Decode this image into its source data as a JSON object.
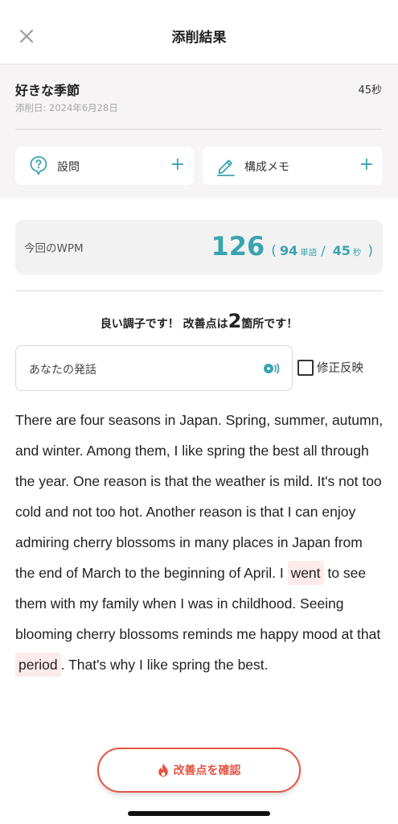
{
  "header": {
    "title": "添削結果",
    "close_icon": "close-icon"
  },
  "topic": {
    "title": "好きな季節",
    "duration": "45秒",
    "date": "添削日: 2024年6月28日"
  },
  "cards": {
    "question_label": "設問",
    "question_icon": "question-circle-icon",
    "memo_label": "構成メモ",
    "memo_icon": "pencil-icon",
    "plus": "+"
  },
  "wpm": {
    "label": "今回のWPM",
    "value": "126",
    "open_paren": "(",
    "words": "94",
    "words_unit": "単語",
    "slash": "/",
    "seconds": "45",
    "seconds_unit": "秒",
    "close_paren": ")"
  },
  "feedback": {
    "prefix": "良い調子です！ 改善点は",
    "count": "2",
    "suffix": "箇所です！"
  },
  "speech": {
    "label": "あなたの発話",
    "audio_icon": "speaker-icon",
    "reflect_label": "修正反映",
    "reflect_checked": false
  },
  "essay": {
    "part1": "There are four seasons in Japan. Spring, summer, autumn, and winter. Among them, I like spring the best all through the year. One reason is that the weather is mild. It's not too cold and not too hot. Another reason is that I can enjoy admiring cherry blossoms in many places in Japan from the end of March to the beginning of April. I ",
    "highlight1": "went",
    "part2": " to see them with my family when I was in childhood. Seeing blooming cherry blossoms reminds me happy mood at that ",
    "highlight2": "period",
    "part3": ". That's why I like spring the best."
  },
  "bottom_button": {
    "label": "改善点を確認",
    "icon": "flame-icon"
  },
  "colors": {
    "accent": "#3aa3b0",
    "alert": "#e45545",
    "highlight": "#fcebea",
    "band": "#f6f4f4"
  }
}
